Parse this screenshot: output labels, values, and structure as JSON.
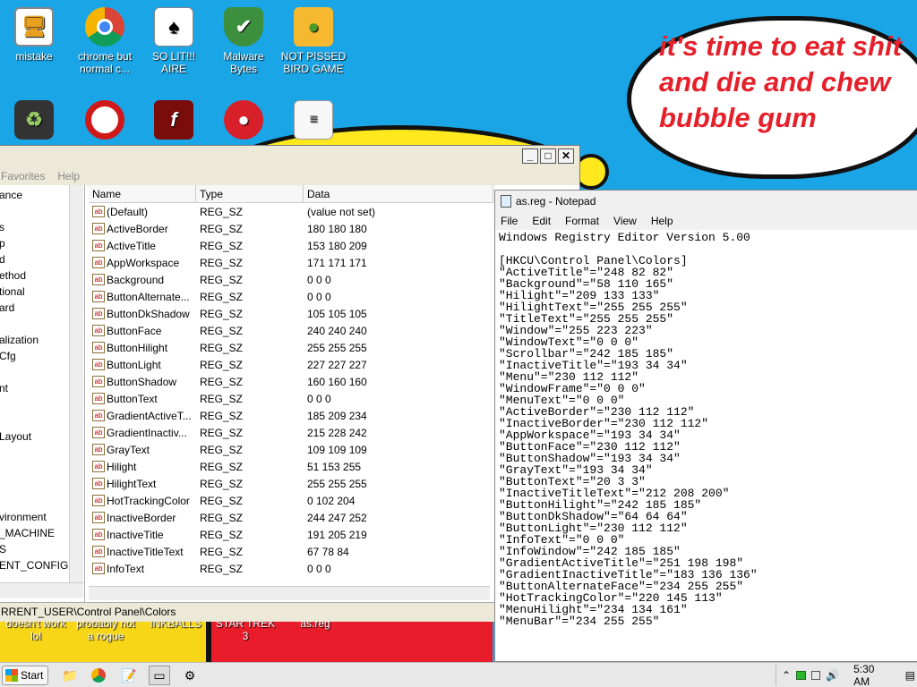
{
  "wallpaper": {
    "bubble_text": "it's time to eat shit and die and chew bubble gum",
    "bottom_labels": [
      "doesn't work lol",
      "probably not a rogue",
      "INKBALLS",
      "STAR TREK 3",
      "as.reg"
    ]
  },
  "desktop_icons": [
    {
      "label": "mistake",
      "icon": "monitor-icon"
    },
    {
      "label": "chrome but normal c...",
      "icon": "chrome-icon"
    },
    {
      "label": "SO LIT!!! AIRE",
      "icon": "solitaire-icon"
    },
    {
      "label": "Malware Bytes",
      "icon": "shield-icon"
    },
    {
      "label": "NOT PISSED BIRD GAME",
      "icon": "pig-icon"
    },
    {
      "label": "",
      "icon": "recycle-bin-icon"
    },
    {
      "label": "",
      "icon": "opera-icon"
    },
    {
      "label": "",
      "icon": "flash-icon"
    },
    {
      "label": "",
      "icon": "angry-bird-icon"
    },
    {
      "label": "",
      "icon": "document-icon"
    }
  ],
  "regedit": {
    "menu": [
      "Favorites",
      "Help"
    ],
    "tree": [
      "ance",
      "s",
      "p",
      "d",
      "ethod",
      "tional",
      "ard",
      "alization",
      "Cfg",
      "nt",
      "Layout",
      "vironment",
      "_MACHINE",
      "S",
      "ENT_CONFIG"
    ],
    "columns": [
      "Name",
      "Type",
      "Data"
    ],
    "rows": [
      {
        "name": "(Default)",
        "type": "REG_SZ",
        "data": "(value not set)"
      },
      {
        "name": "ActiveBorder",
        "type": "REG_SZ",
        "data": "180 180 180"
      },
      {
        "name": "ActiveTitle",
        "type": "REG_SZ",
        "data": "153 180 209"
      },
      {
        "name": "AppWorkspace",
        "type": "REG_SZ",
        "data": "171 171 171"
      },
      {
        "name": "Background",
        "type": "REG_SZ",
        "data": "0 0 0"
      },
      {
        "name": "ButtonAlternate...",
        "type": "REG_SZ",
        "data": "0 0 0"
      },
      {
        "name": "ButtonDkShadow",
        "type": "REG_SZ",
        "data": "105 105 105"
      },
      {
        "name": "ButtonFace",
        "type": "REG_SZ",
        "data": "240 240 240"
      },
      {
        "name": "ButtonHilight",
        "type": "REG_SZ",
        "data": "255 255 255"
      },
      {
        "name": "ButtonLight",
        "type": "REG_SZ",
        "data": "227 227 227"
      },
      {
        "name": "ButtonShadow",
        "type": "REG_SZ",
        "data": "160 160 160"
      },
      {
        "name": "ButtonText",
        "type": "REG_SZ",
        "data": "0 0 0"
      },
      {
        "name": "GradientActiveT...",
        "type": "REG_SZ",
        "data": "185 209 234"
      },
      {
        "name": "GradientInactiv...",
        "type": "REG_SZ",
        "data": "215 228 242"
      },
      {
        "name": "GrayText",
        "type": "REG_SZ",
        "data": "109 109 109"
      },
      {
        "name": "Hilight",
        "type": "REG_SZ",
        "data": "51 153 255"
      },
      {
        "name": "HilightText",
        "type": "REG_SZ",
        "data": "255 255 255"
      },
      {
        "name": "HotTrackingColor",
        "type": "REG_SZ",
        "data": "0 102 204"
      },
      {
        "name": "InactiveBorder",
        "type": "REG_SZ",
        "data": "244 247 252"
      },
      {
        "name": "InactiveTitle",
        "type": "REG_SZ",
        "data": "191 205 219"
      },
      {
        "name": "InactiveTitleText",
        "type": "REG_SZ",
        "data": "67 78 84"
      },
      {
        "name": "InfoText",
        "type": "REG_SZ",
        "data": "0 0 0"
      }
    ],
    "status": "RRENT_USER\\Control Panel\\Colors"
  },
  "notepad": {
    "title": "as.reg - Notepad",
    "menu": [
      "File",
      "Edit",
      "Format",
      "View",
      "Help"
    ],
    "lines": [
      "Windows Registry Editor Version 5.00",
      "",
      "[HKCU\\Control Panel\\Colors]",
      "\"ActiveTitle\"=\"248 82 82\"",
      "\"Background\"=\"58 110 165\"",
      "\"Hilight\"=\"209 133 133\"",
      "\"HilightText\"=\"255 255 255\"",
      "\"TitleText\"=\"255 255 255\"",
      "\"Window\"=\"255 223 223\"",
      "\"WindowText\"=\"0 0 0\"",
      "\"Scrollbar\"=\"242 185 185\"",
      "\"InactiveTitle\"=\"193 34 34\"",
      "\"Menu\"=\"230 112 112\"",
      "\"WindowFrame\"=\"0 0 0\"",
      "\"MenuText\"=\"0 0 0\"",
      "\"ActiveBorder\"=\"230 112 112\"",
      "\"InactiveBorder\"=\"230 112 112\"",
      "\"AppWorkspace\"=\"193 34 34\"",
      "\"ButtonFace\"=\"230 112 112\"",
      "\"ButtonShadow\"=\"193 34 34\"",
      "\"GrayText\"=\"193 34 34\"",
      "\"ButtonText\"=\"20 3 3\"",
      "\"InactiveTitleText\"=\"212 208 200\"",
      "\"ButtonHilight\"=\"242 185 185\"",
      "\"ButtonDkShadow\"=\"64 64 64\"",
      "\"ButtonLight\"=\"230 112 112\"",
      "\"InfoText\"=\"0 0 0\"",
      "\"InfoWindow\"=\"242 185 185\"",
      "\"GradientActiveTitle\"=\"251 198 198\"",
      "\"GradientInactiveTitle\"=\"183 136 136\"",
      "\"ButtonAlternateFace\"=\"234 255 255\"",
      "\"HotTrackingColor\"=\"220 145 113\"",
      "\"MenuHilight\"=\"234 134 161\"",
      "\"MenuBar\"=\"234 255 255\""
    ]
  },
  "taskbar": {
    "start_label": "Start",
    "clock": "5:30 AM"
  },
  "colors": {
    "wallpaper_blue": "#1aa5e6",
    "wallpaper_red": "#e81c2a",
    "bubble_text_red": "#e5202a"
  }
}
